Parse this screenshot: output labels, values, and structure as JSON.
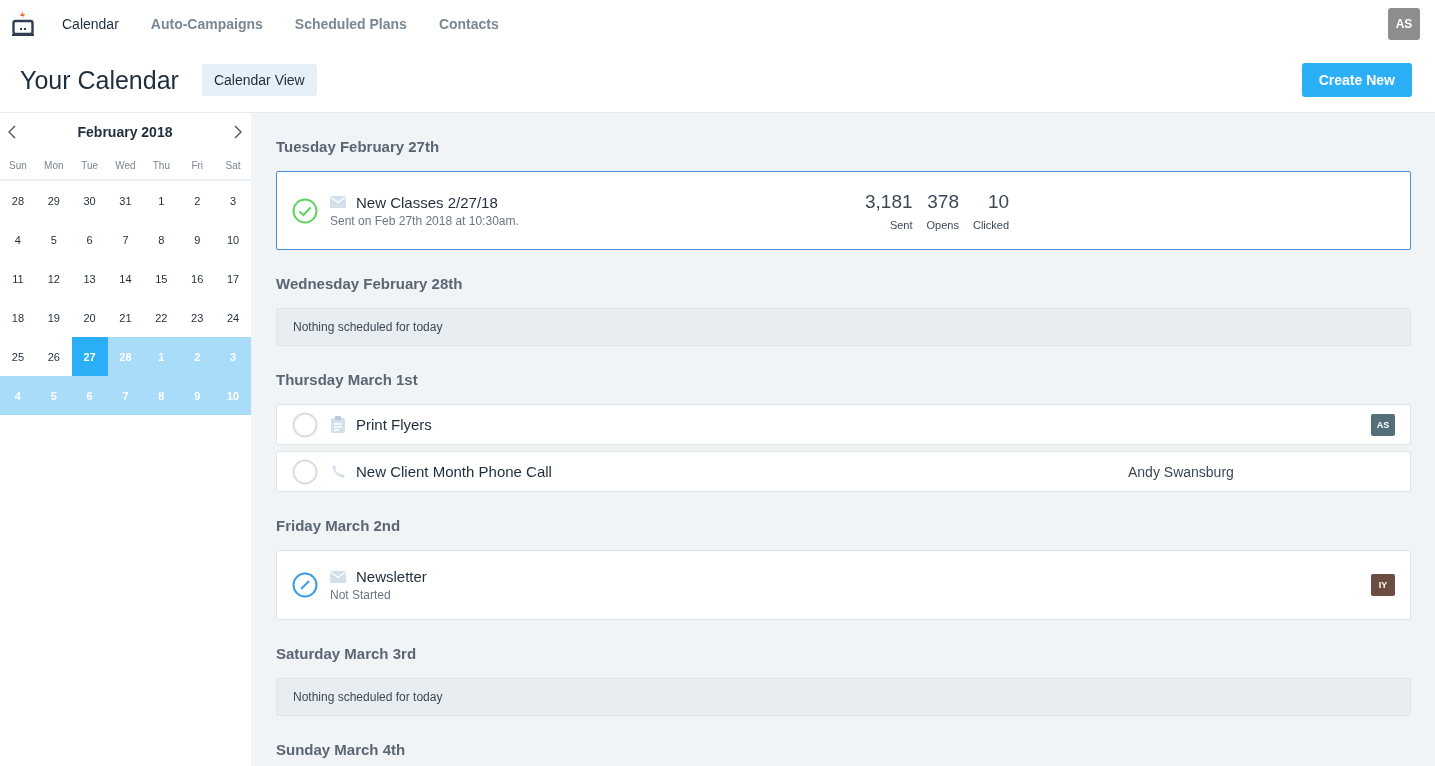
{
  "nav": {
    "items": [
      {
        "label": "Calendar",
        "selected": true
      },
      {
        "label": "Auto-Campaigns",
        "selected": false
      },
      {
        "label": "Scheduled Plans",
        "selected": false
      },
      {
        "label": "Contacts",
        "selected": false
      }
    ],
    "user_initials": "AS"
  },
  "header": {
    "title": "Your Calendar",
    "view_button": "Calendar View",
    "create_button": "Create New"
  },
  "calendar": {
    "month": "February 2018",
    "weekdays": [
      "Sun",
      "Mon",
      "Tue",
      "Wed",
      "Thu",
      "Fri",
      "Sat"
    ],
    "days": [
      {
        "label": "28",
        "selected": false,
        "in_range": false
      },
      {
        "label": "29",
        "selected": false,
        "in_range": false
      },
      {
        "label": "30",
        "selected": false,
        "in_range": false
      },
      {
        "label": "31",
        "selected": false,
        "in_range": false
      },
      {
        "label": "1",
        "selected": false,
        "in_range": false
      },
      {
        "label": "2",
        "selected": false,
        "in_range": false
      },
      {
        "label": "3",
        "selected": false,
        "in_range": false
      },
      {
        "label": "4",
        "selected": false,
        "in_range": false
      },
      {
        "label": "5",
        "selected": false,
        "in_range": false
      },
      {
        "label": "6",
        "selected": false,
        "in_range": false
      },
      {
        "label": "7",
        "selected": false,
        "in_range": false
      },
      {
        "label": "8",
        "selected": false,
        "in_range": false
      },
      {
        "label": "9",
        "selected": false,
        "in_range": false
      },
      {
        "label": "10",
        "selected": false,
        "in_range": false
      },
      {
        "label": "11",
        "selected": false,
        "in_range": false
      },
      {
        "label": "12",
        "selected": false,
        "in_range": false
      },
      {
        "label": "13",
        "selected": false,
        "in_range": false
      },
      {
        "label": "14",
        "selected": false,
        "in_range": false
      },
      {
        "label": "15",
        "selected": false,
        "in_range": false
      },
      {
        "label": "16",
        "selected": false,
        "in_range": false
      },
      {
        "label": "17",
        "selected": false,
        "in_range": false
      },
      {
        "label": "18",
        "selected": false,
        "in_range": false
      },
      {
        "label": "19",
        "selected": false,
        "in_range": false
      },
      {
        "label": "20",
        "selected": false,
        "in_range": false
      },
      {
        "label": "21",
        "selected": false,
        "in_range": false
      },
      {
        "label": "22",
        "selected": false,
        "in_range": false
      },
      {
        "label": "23",
        "selected": false,
        "in_range": false
      },
      {
        "label": "24",
        "selected": false,
        "in_range": false
      },
      {
        "label": "25",
        "selected": false,
        "in_range": false
      },
      {
        "label": "26",
        "selected": false,
        "in_range": false
      },
      {
        "label": "27",
        "selected": true,
        "in_range": true
      },
      {
        "label": "28",
        "selected": false,
        "in_range": true
      },
      {
        "label": "1",
        "selected": false,
        "in_range": true
      },
      {
        "label": "2",
        "selected": false,
        "in_range": true
      },
      {
        "label": "3",
        "selected": false,
        "in_range": true
      },
      {
        "label": "4",
        "selected": false,
        "in_range": true
      },
      {
        "label": "5",
        "selected": false,
        "in_range": true
      },
      {
        "label": "6",
        "selected": false,
        "in_range": true
      },
      {
        "label": "7",
        "selected": false,
        "in_range": true
      },
      {
        "label": "8",
        "selected": false,
        "in_range": true
      },
      {
        "label": "9",
        "selected": false,
        "in_range": true
      },
      {
        "label": "10",
        "selected": false,
        "in_range": true
      }
    ]
  },
  "agenda": [
    {
      "date": "Tuesday February 27th",
      "kind": "events",
      "items": [
        {
          "kind": "email",
          "completed": true,
          "selected": true,
          "title": "New Classes 2/27/18",
          "subtitle": "Sent on Feb 27th 2018 at 10:30am.",
          "stats": [
            {
              "value": "3,181",
              "label": "Sent"
            },
            {
              "value": "378",
              "label": "Opens"
            },
            {
              "value": "10",
              "label": "Clicked"
            }
          ]
        }
      ]
    },
    {
      "date": "Wednesday February 28th",
      "kind": "empty",
      "message": "Nothing scheduled for today"
    },
    {
      "date": "Thursday March 1st",
      "kind": "events",
      "items": [
        {
          "kind": "task",
          "completed": false,
          "selected": false,
          "title": "Print Flyers",
          "badge": {
            "initials": "AS",
            "color": "#546e7a"
          }
        },
        {
          "kind": "call",
          "completed": false,
          "selected": false,
          "title": "New Client Month Phone Call",
          "assignee": "Andy Swansburg"
        }
      ]
    },
    {
      "date": "Friday March 2nd",
      "kind": "events",
      "items": [
        {
          "kind": "email",
          "completed": false,
          "selected": false,
          "title": "Newsletter",
          "subtitle": "Not Started",
          "badge": {
            "initials": "IY",
            "color": "#6d4c41"
          }
        }
      ]
    },
    {
      "date": "Saturday March 3rd",
      "kind": "empty",
      "message": "Nothing scheduled for today"
    },
    {
      "date": "Sunday March 4th"
    }
  ]
}
